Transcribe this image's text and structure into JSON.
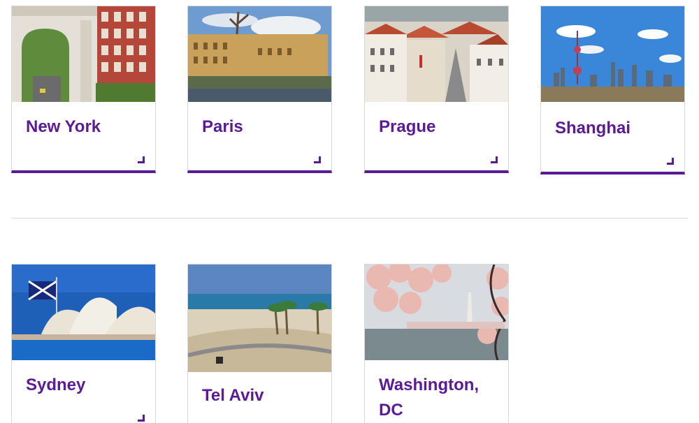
{
  "accent_color": "#5b1a96",
  "destinations": [
    {
      "name": "New York",
      "image_icon": "washington-square-arch-image"
    },
    {
      "name": "Paris",
      "image_icon": "paris-seine-buildings-image"
    },
    {
      "name": "Prague",
      "image_icon": "prague-rooftops-image"
    },
    {
      "name": "Shanghai",
      "image_icon": "shanghai-skyline-image"
    },
    {
      "name": "Sydney",
      "image_icon": "sydney-opera-house-image"
    },
    {
      "name": "Tel Aviv",
      "image_icon": "tel-aviv-beach-image"
    },
    {
      "name": "Washington, DC",
      "image_icon": "washington-monument-cherry-blossoms-image"
    }
  ]
}
